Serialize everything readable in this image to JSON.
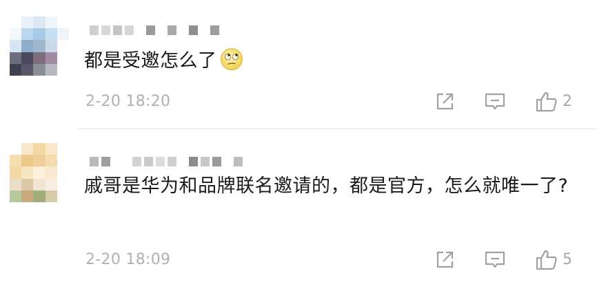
{
  "comments": [
    {
      "text": "都是受邀怎么了",
      "emoji": "eye-roll-emoji",
      "timestamp": "2-20 18:20",
      "likes": "2"
    },
    {
      "text": "戚哥是华为和品牌联名邀请的，都是官方，怎么就唯一了?",
      "timestamp": "2-20 18:09",
      "likes": "5"
    }
  ],
  "colors": {
    "text": "#1a1a1a",
    "meta": "#b0b0b0",
    "icon": "#a0a0a0",
    "divider": "#f0f0f0"
  }
}
